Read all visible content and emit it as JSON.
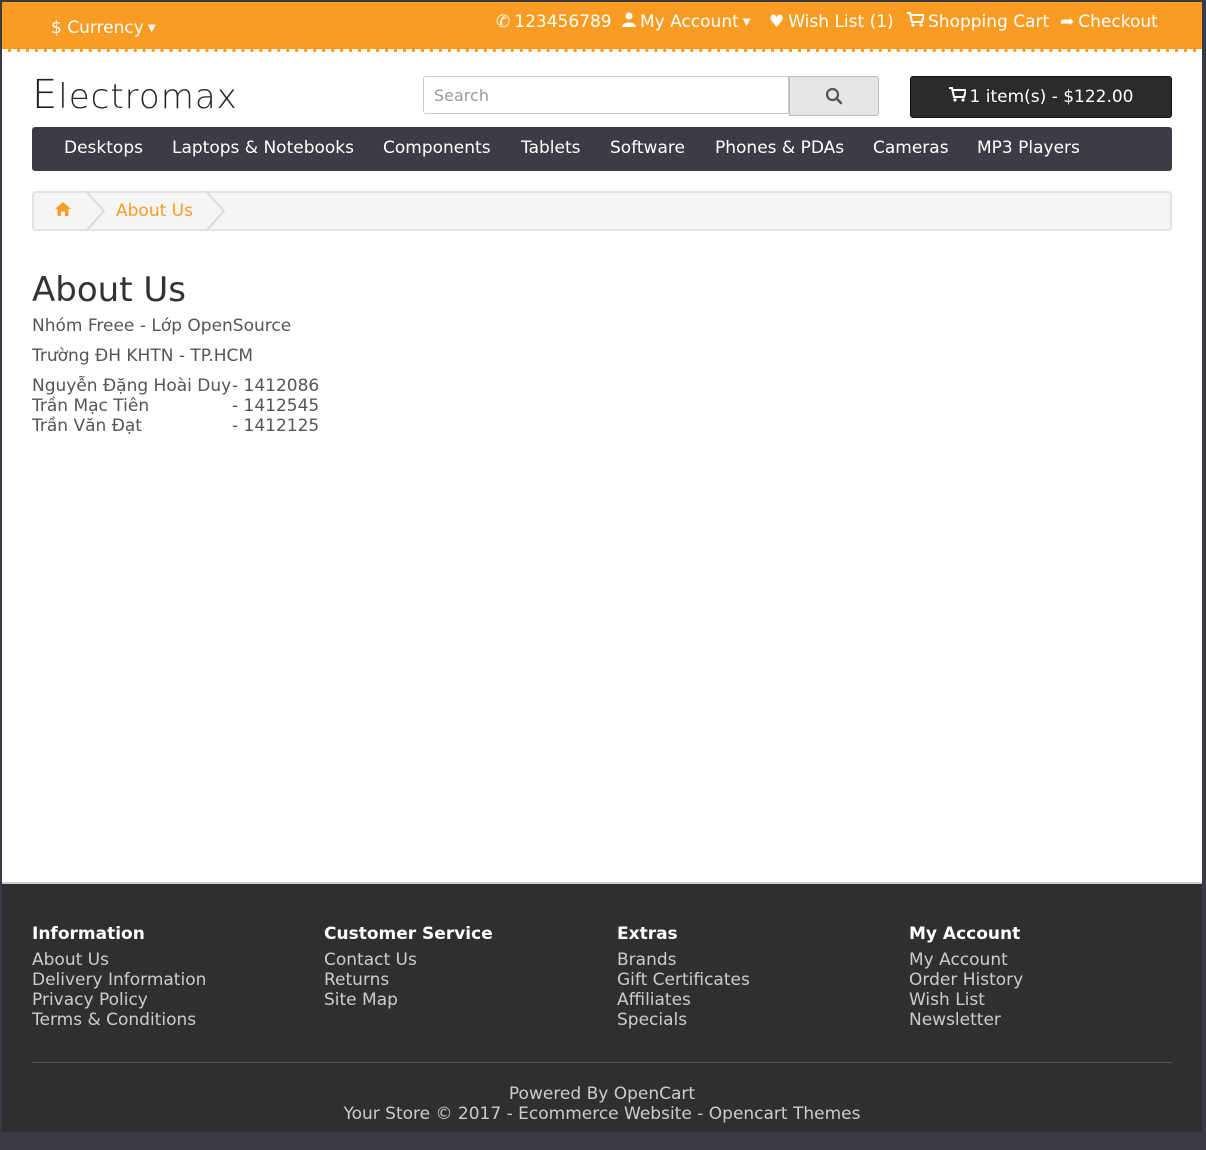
{
  "topbar": {
    "currency_label": "$ Currency",
    "phone": "123456789",
    "my_account": "My Account",
    "wish_list": "Wish List (1)",
    "shopping_cart": "Shopping Cart",
    "checkout": "Checkout",
    "accent_color": "#f99c24"
  },
  "header": {
    "logo_initial": "E",
    "logo_rest": "lectromax",
    "search_placeholder": "Search",
    "cart_summary": "1 item(s) - $122.00"
  },
  "menu": {
    "items": [
      "Desktops",
      "Laptops & Notebooks",
      "Components",
      "Tablets",
      "Software",
      "Phones & PDAs",
      "Cameras",
      "MP3 Players"
    ]
  },
  "breadcrumb": {
    "current": "About Us"
  },
  "content": {
    "title": "About Us",
    "line1": "Nhóm Freee - Lớp OpenSource",
    "line2": "Trường ĐH KHTN - TP.HCM",
    "members": [
      {
        "name": "Nguyễn Đặng Hoài Duy",
        "id": "- 1412086"
      },
      {
        "name": "Trần Mạc Tiên",
        "id": "- 1412545"
      },
      {
        "name": "Trần Văn Đạt",
        "id": "- 1412125"
      }
    ]
  },
  "footer": {
    "columns": [
      {
        "heading": "Information",
        "links": [
          "About Us",
          "Delivery Information",
          "Privacy Policy",
          "Terms & Conditions"
        ]
      },
      {
        "heading": "Customer Service",
        "links": [
          "Contact Us",
          "Returns",
          "Site Map"
        ]
      },
      {
        "heading": "Extras",
        "links": [
          "Brands",
          "Gift Certificates",
          "Affiliates",
          "Specials"
        ]
      },
      {
        "heading": "My Account",
        "links": [
          "My Account",
          "Order History",
          "Wish List",
          "Newsletter"
        ]
      }
    ],
    "powered_prefix": "Powered By",
    "powered_link": "OpenCart",
    "copyright": "Your Store © 2017 -",
    "ecommerce_link": "Ecommerce Website",
    "dash": "-",
    "themes_link": "Opencart Themes"
  }
}
